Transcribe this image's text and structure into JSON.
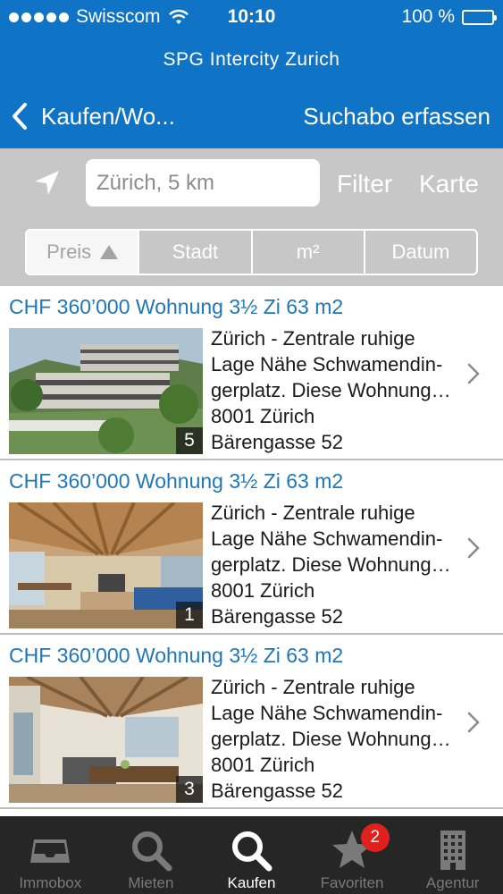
{
  "status_bar": {
    "carrier": "Swisscom",
    "time": "10:10",
    "battery": "100 %"
  },
  "header": {
    "app_title": "SPG Intercity Zurich",
    "back_label": "Kaufen/Wo...",
    "right_action": "Suchabo erfassen"
  },
  "search": {
    "value": "Zürich, 5 km",
    "filter_label": "Filter",
    "map_label": "Karte"
  },
  "sort_tabs": [
    {
      "label": "Preis",
      "selected": true,
      "direction": "ascending"
    },
    {
      "label": "Stadt"
    },
    {
      "label": "m²"
    },
    {
      "label": "Datum"
    }
  ],
  "listings": [
    {
      "title": "CHF 360’000 Wohnung 3½ Zi 63 m2",
      "desc_line1": "Zürich - Zentrale ruhige",
      "desc_line2": "Lage Nähe Schwamendin-",
      "desc_line3": "gerplatz. Diese Wohnung…",
      "zip_city": "8001 Zürich",
      "street": "Bärengasse 52",
      "photo_count": "5"
    },
    {
      "title": "CHF 360’000 Wohnung 3½ Zi 63 m2",
      "desc_line1": "Zürich - Zentrale ruhige",
      "desc_line2": "Lage Nähe Schwamendin-",
      "desc_line3": "gerplatz. Diese Wohnung…",
      "zip_city": "8001 Zürich",
      "street": "Bärengasse 52",
      "photo_count": "1"
    },
    {
      "title": "CHF 360’000 Wohnung 3½ Zi 63 m2",
      "desc_line1": "Zürich - Zentrale ruhige",
      "desc_line2": "Lage Nähe Schwamendin-",
      "desc_line3": "gerplatz. Diese Wohnung…",
      "zip_city": "8001 Zürich",
      "street": "Bärengasse 52",
      "photo_count": "3"
    }
  ],
  "tabbar": {
    "items": [
      {
        "label": "Immobox",
        "icon": "inbox-icon"
      },
      {
        "label": "Mieten",
        "icon": "search-icon"
      },
      {
        "label": "Kaufen",
        "icon": "search-icon",
        "active": true
      },
      {
        "label": "Favoriten",
        "icon": "star-icon",
        "badge": "2"
      },
      {
        "label": "Agentur",
        "icon": "building-icon"
      }
    ]
  },
  "colors": {
    "header_blue": "#0f74c6",
    "link_blue": "#1f76b8",
    "search_bg": "#c7c7c7",
    "tabbar_bg": "#262626",
    "badge_red": "#e0201c"
  }
}
